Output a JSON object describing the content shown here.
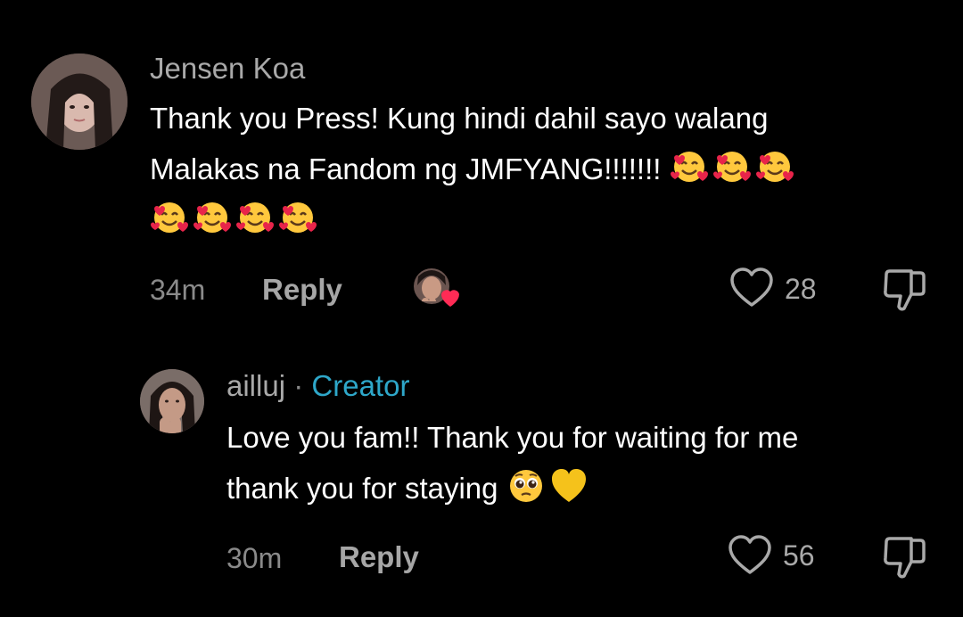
{
  "comments": [
    {
      "username": "Jensen Koa",
      "text_line1": "Thank you Press! Kung hindi dahil sayo walang",
      "text_line2": "Malakas na Fandom ng JMFYANG!!!!!!! ",
      "time": "34m",
      "reply_label": "Reply",
      "likes": "28",
      "emoji": "smiling-face-with-hearts"
    },
    {
      "username": "ailluj",
      "separator": "·",
      "badge": "Creator",
      "text_line1": "Love you fam!! Thank you for waiting for me",
      "text_line2": "thank you for staying ",
      "time": "30m",
      "reply_label": "Reply",
      "likes": "56"
    }
  ],
  "icons": {
    "like": "heart-outline-icon",
    "dislike": "thumbs-down-icon"
  },
  "colors": {
    "background": "#000000",
    "creator_badge": "#2ea7c9",
    "heart": "#ff2b55"
  }
}
